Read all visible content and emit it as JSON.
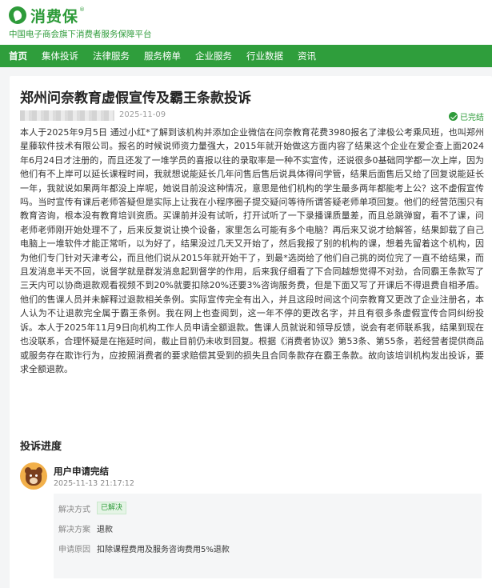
{
  "header": {
    "logo_text": "消费保",
    "logo_reg": "®",
    "tagline": "中国电子商会旗下消费者服务保障平台"
  },
  "nav": {
    "items": [
      {
        "label": "首页",
        "active": true
      },
      {
        "label": "集体投诉",
        "active": false
      },
      {
        "label": "法律服务",
        "active": false
      },
      {
        "label": "服务榜单",
        "active": false
      },
      {
        "label": "企业服务",
        "active": false
      },
      {
        "label": "行业数据",
        "active": false
      },
      {
        "label": "资讯",
        "active": false
      }
    ]
  },
  "complaint": {
    "title": "郑州问奈教育虚假宣传及霸王条款投诉",
    "date": "2025-11-09",
    "status": "已完结",
    "body": "本人于2025年9月5日 通过小红*了解到该机构并添加企业微信在问奈教育花费3980报名了津极公考乘风班，也叫郑州星藤软件技术有限公司。报名的时候说师资力量强大，2015年就开始做这方面内容了结果这个企业在爱企查上面2024年6月24日才注册的，而且还发了一堆学员的喜报以往的录取率是一种不实宣传，还说很多0基础同学都一次上岸，因为他们有不上岸可以延长课程时间，我就想说能延长几年问售后售后说具体得问学管，结果后面售后又给了回复说能延长一年，我就说如果两年都没上岸呢，她说目前没这种情况，意思是他们机构的学生最多两年都能考上公？这不虚假宣传吗。当时宣传有课后老师答疑但是实际上让我在小程序圈子提交疑问等待所谓答疑老师单项回复。他们的经营范围只有教育咨询，根本没有教育培训资质。买课前并没有试听，打开试听了一下录播课质量差，而且总跳弹窗，看不了课，问老师老师刚开始处理不了，后来反复说让换个设备，家里怎么可能有多个电脑？再后来又说才给解答，结果卸载了自己电脑上一堆软件才能正常听，以为好了，结果没过几天又开始了，然后我报了别的机构的课，想着先留着这个机构，因为他们专门针对天津考公，而且他们说从2015年就开始干了，到最*选岗给了他们自己挑的岗位完了一直不给结果，而且发消息半天不回，说督学就是群发消息起到督学的作用，后来我仔细看了下合同越想觉得不对劲，合同霸王条款写了三天内可以协商退款观看视频不到20%就要扣除20%还要3%咨询服务费，但是下面又写了开课后不得退费自相矛盾。他们的售课人员并未解释过退款相关条例。实际宣传完全有出入，并且这段时间这个问奈教育又更改了企业注册名，本人认为不让退款完全属于霸王条例。我在网上也查阅到，这一年不停的更改名字，并且有很多条虚假宣传合同纠纷投诉。本人于2025年11月9日向机构工作人员申请全额退款。售课人员就说和领导反馈，说会有老师联系我，结果到现在也没联系，合理怀疑是在拖延时间，截止目前仍未收到回复。根据《消费者协议》第53条、第55条，若经营者提供商品或服务存在欺诈行为，应按照消费者的要求赔偿其受到的损失且合同条款存在霸王条款。故向该培训机构发出投诉，要求全额退款。"
  },
  "progress": {
    "title": "投诉进度",
    "event_title": "用户申请完结",
    "event_time": "2025-11-13 21:17:12",
    "rows": [
      {
        "label": "解决方式",
        "value": "已解决",
        "badge": true
      },
      {
        "label": "解决方案",
        "value": "退款",
        "badge": false
      },
      {
        "label": "申请原因",
        "value": "扣除课程费用及服务咨询费用5%退款",
        "badge": false
      }
    ]
  },
  "colors": {
    "brand_green": "#2e9b3a",
    "nav_bg": "#2f9e3c"
  },
  "icons": {
    "logo": "leaf-logo-icon",
    "status": "check-circle-icon",
    "avatar": "bear-avatar-icon"
  }
}
